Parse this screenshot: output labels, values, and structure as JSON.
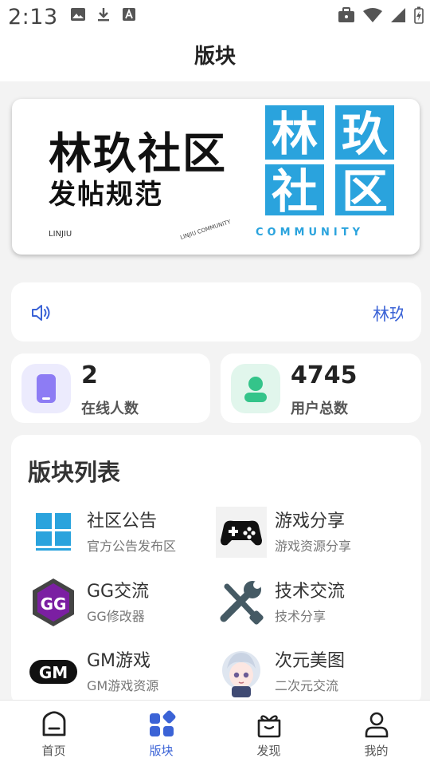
{
  "status_bar": {
    "time": "2:13"
  },
  "app_bar": {
    "title": "版块"
  },
  "banner": {
    "title": "林玖社区",
    "subtitle": "发帖规范",
    "english": "LINJIU",
    "small_text": "LINJIU COMMUNITY",
    "logo_chars": [
      "林",
      "玖",
      "社",
      "区"
    ],
    "logo_english": "COMMUNITY"
  },
  "notice": {
    "text": "林玖"
  },
  "stats": [
    {
      "value": "2",
      "label": "在线人数"
    },
    {
      "value": "4745",
      "label": "用户总数"
    }
  ],
  "board_list": {
    "title": "版块列表",
    "items": [
      {
        "name": "社区公告",
        "desc": "官方公告发布区",
        "icon": "community-logo-icon"
      },
      {
        "name": "游戏分享",
        "desc": "游戏资源分享",
        "icon": "gamepad-icon"
      },
      {
        "name": "GG交流",
        "desc": "GG修改器",
        "icon": "gg-icon"
      },
      {
        "name": "技术交流",
        "desc": "技术分享",
        "icon": "tools-icon"
      },
      {
        "name": "GM游戏",
        "desc": "GM游戏资源",
        "icon": "gm-icon"
      },
      {
        "name": "次元美图",
        "desc": "二次元交流",
        "icon": "anime-avatar-icon"
      }
    ]
  },
  "bottom_nav": [
    {
      "label": "首页",
      "icon": "home-icon",
      "active": false
    },
    {
      "label": "版块",
      "icon": "grid-icon",
      "active": true
    },
    {
      "label": "发现",
      "icon": "gift-icon",
      "active": false
    },
    {
      "label": "我的",
      "icon": "user-icon",
      "active": false
    }
  ],
  "colors": {
    "accent": "#3b63d6",
    "logo_blue": "#2aa3dd",
    "purple": "#8d7cf4",
    "green": "#34c48a"
  }
}
